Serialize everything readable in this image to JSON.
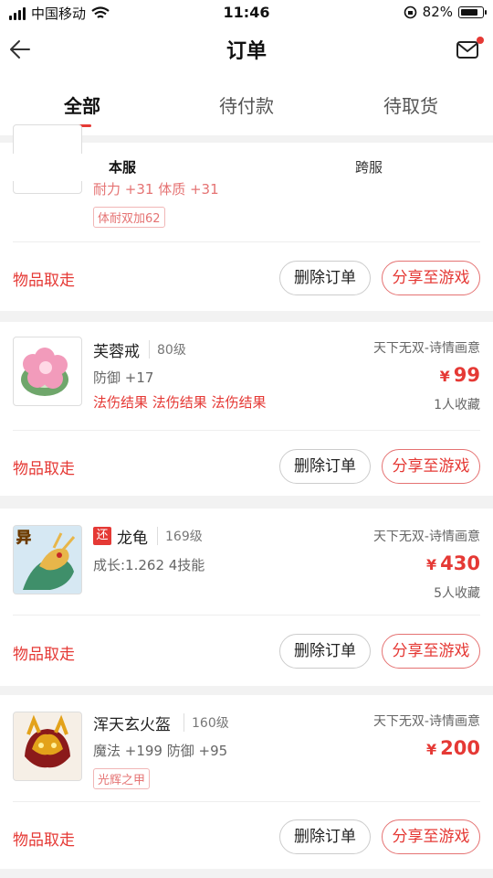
{
  "status_bar": {
    "carrier": "中国移动",
    "time": "11:46",
    "battery": "82%"
  },
  "header": {
    "title": "订单"
  },
  "tabs": [
    {
      "label": "全部"
    },
    {
      "label": "待付款"
    },
    {
      "label": "待取货"
    }
  ],
  "subtabs": [
    {
      "label": "本服"
    },
    {
      "label": "跨服"
    }
  ],
  "orders": [
    {
      "attr_partial": "耐力 +31 体质 +31",
      "tag": "体耐双加62",
      "take_label": "物品取走",
      "delete_label": "删除订单",
      "share_label": "分享至游戏"
    },
    {
      "name": "芙蓉戒",
      "level": "80级",
      "server": "天下无双-诗情画意",
      "price": "99",
      "attr": "防御 +17",
      "effects": "法伤结果 法伤结果 法伤结果",
      "collect": "1人收藏",
      "take_label": "物品取走",
      "delete_label": "删除订单",
      "share_label": "分享至游戏"
    },
    {
      "badge": "还",
      "name": "龙龟",
      "level": "169级",
      "server": "天下无双-诗情画意",
      "price": "430",
      "attr": "成长:1.262 4技能",
      "collect": "5人收藏",
      "thumb_badge": "异",
      "take_label": "物品取走",
      "delete_label": "删除订单",
      "share_label": "分享至游戏"
    },
    {
      "name": "浑天玄火盔",
      "level": "160级",
      "server": "天下无双-诗情画意",
      "price": "200",
      "attr": "魔法 +199 防御 +95",
      "tag": "光辉之甲",
      "take_label": "物品取走",
      "delete_label": "删除订单",
      "share_label": "分享至游戏"
    }
  ],
  "currency_symbol": "¥",
  "colors": {
    "accent": "#e53935",
    "background": "#f2f2f2"
  }
}
